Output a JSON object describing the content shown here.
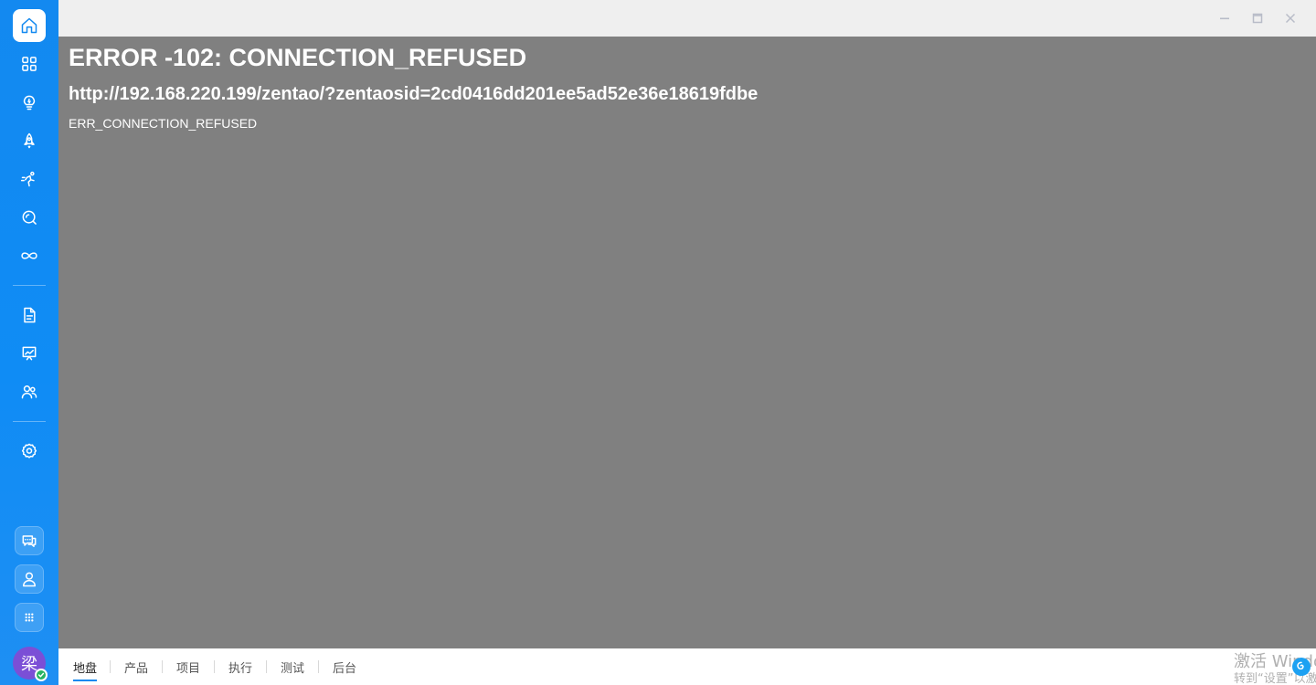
{
  "sidebar": {
    "items": [
      {
        "icon": "home-icon",
        "active": true
      },
      {
        "icon": "dashboard-grid-icon"
      },
      {
        "icon": "lightbulb-icon"
      },
      {
        "icon": "rocket-icon"
      },
      {
        "icon": "sprint-runner-icon"
      },
      {
        "icon": "qa-search-icon"
      },
      {
        "icon": "infinity-icon"
      },
      {
        "icon": "document-icon"
      },
      {
        "icon": "presentation-chart-icon"
      },
      {
        "icon": "team-users-icon"
      },
      {
        "icon": "settings-gear-icon"
      }
    ],
    "bottom_items": [
      {
        "icon": "chat-icon"
      },
      {
        "icon": "user-profile-icon"
      },
      {
        "icon": "apps-grid-icon"
      }
    ],
    "avatar": {
      "initial": "梁",
      "status": "online"
    },
    "colors": {
      "background": "#1389f0",
      "active_bg": "#ffffff",
      "active_icon": "#1389f0"
    }
  },
  "window": {
    "controls": [
      "minimize-icon",
      "maximize-icon",
      "close-icon"
    ]
  },
  "error": {
    "title": "ERROR -102: CONNECTION_REFUSED",
    "url": "http://192.168.220.199/zentao/?zentaosid=2cd0416dd201ee5ad52e36e18619fdbe",
    "code": "ERR_CONNECTION_REFUSED",
    "background": "#808080"
  },
  "tabs": [
    {
      "label": "地盘",
      "active": true
    },
    {
      "label": "产品"
    },
    {
      "label": "项目"
    },
    {
      "label": "执行"
    },
    {
      "label": "测试"
    },
    {
      "label": "后台"
    }
  ],
  "watermark": {
    "line1": "激活 Windows",
    "line2": "转到“设置”以激活 Windows。"
  }
}
